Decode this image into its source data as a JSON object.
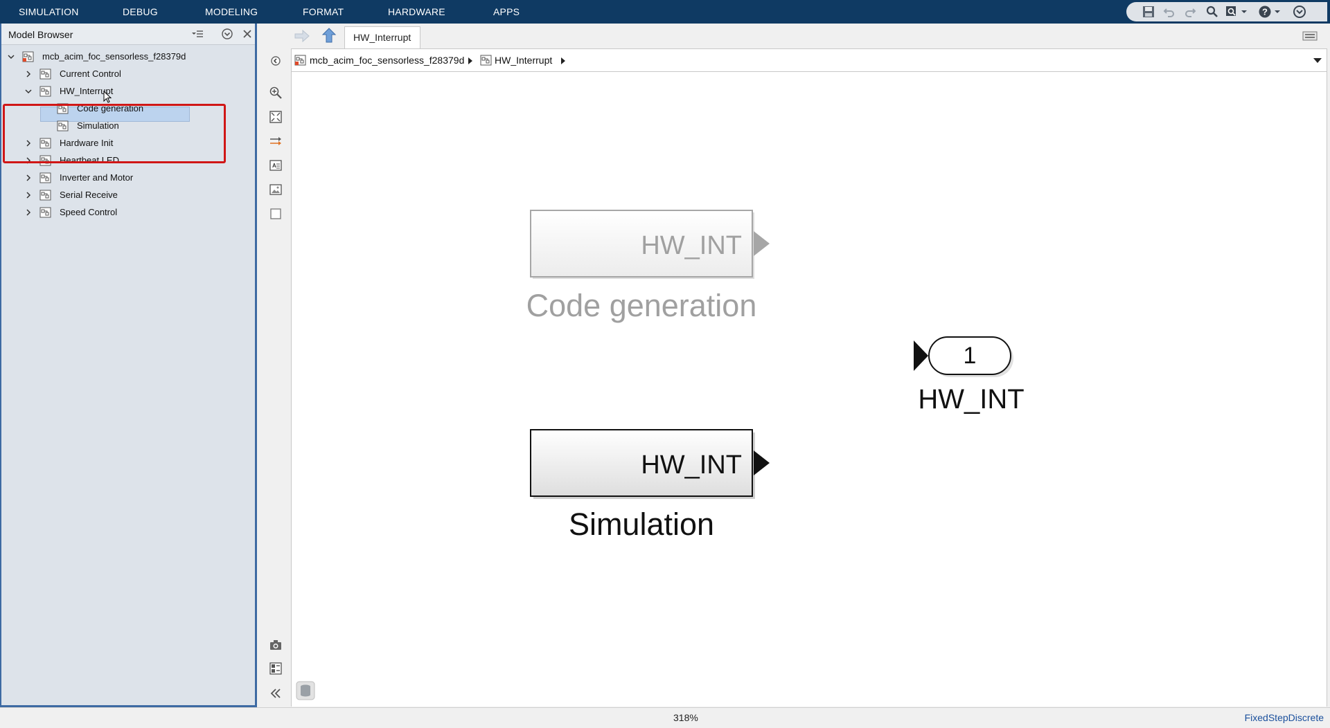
{
  "menu": {
    "tabs": [
      "SIMULATION",
      "DEBUG",
      "MODELING",
      "FORMAT",
      "HARDWARE",
      "APPS"
    ]
  },
  "quick_access": {
    "icons": [
      "save-icon",
      "undo-icon",
      "redo-icon",
      "search-icon",
      "find-options-icon",
      "help-icon",
      "minimize-ribbon-icon"
    ]
  },
  "model_browser": {
    "title": "Model Browser",
    "tree": [
      {
        "label": "mcb_acim_foc_sensorless_f28379d",
        "level": 0,
        "expanded": true,
        "root": true
      },
      {
        "label": "Current Control",
        "level": 1,
        "expanded": false
      },
      {
        "label": "HW_Interrupt",
        "level": 1,
        "expanded": true,
        "selected": true
      },
      {
        "label": "Code generation",
        "level": 2
      },
      {
        "label": "Simulation",
        "level": 2
      },
      {
        "label": "Hardware Init",
        "level": 1,
        "expanded": false
      },
      {
        "label": "Heartbeat LED",
        "level": 1,
        "expanded": false
      },
      {
        "label": "Inverter and Motor",
        "level": 1,
        "expanded": false
      },
      {
        "label": "Serial Receive",
        "level": 1,
        "expanded": false
      },
      {
        "label": "Speed Control",
        "level": 1,
        "expanded": false
      }
    ]
  },
  "editor": {
    "active_tab": "HW_Interrupt",
    "breadcrumb": [
      "mcb_acim_foc_sensorless_f28379d",
      "HW_Interrupt"
    ]
  },
  "diagram": {
    "block_codegen": {
      "port_label": "HW_INT",
      "name": "Code generation",
      "commented_out": true
    },
    "block_simulation": {
      "port_label": "HW_INT",
      "name": "Simulation"
    },
    "inport": {
      "number": "1",
      "name": "HW_INT"
    }
  },
  "status": {
    "zoom": "318%",
    "solver": "FixedStepDiscrete"
  },
  "colors": {
    "menubar": "#0f3a63",
    "browser_bg": "#dde3ea",
    "selection": "#bcd3ee",
    "highlight_box": "#d01616",
    "commented_gray": "#a0a0a0",
    "solver_link": "#1a4f9c"
  }
}
